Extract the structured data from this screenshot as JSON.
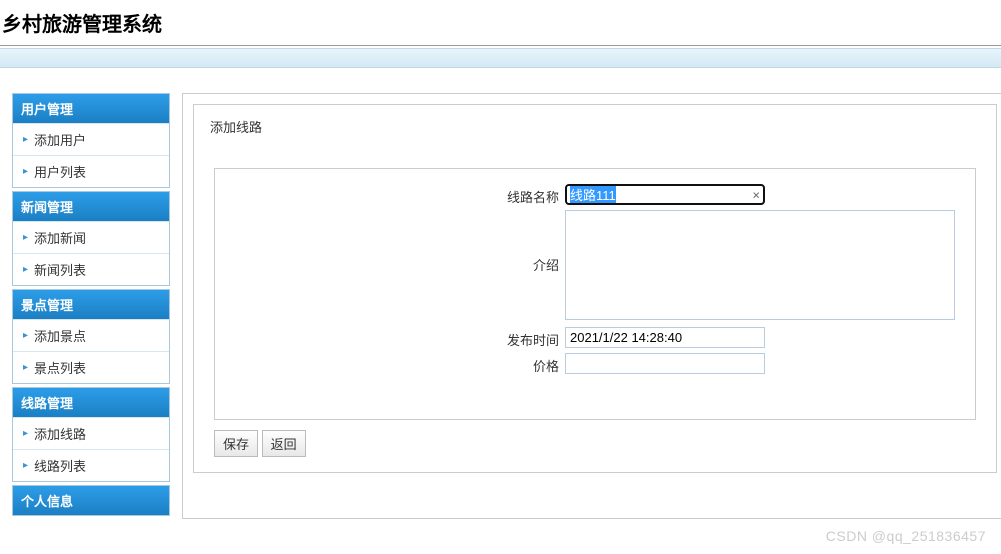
{
  "header": {
    "title": "乡村旅游管理系统"
  },
  "sidebar": {
    "sections": [
      {
        "header": "用户管理",
        "items": [
          {
            "label": "添加用户"
          },
          {
            "label": "用户列表"
          }
        ]
      },
      {
        "header": "新闻管理",
        "items": [
          {
            "label": "添加新闻"
          },
          {
            "label": "新闻列表"
          }
        ]
      },
      {
        "header": "景点管理",
        "items": [
          {
            "label": "添加景点"
          },
          {
            "label": "景点列表"
          }
        ]
      },
      {
        "header": "线路管理",
        "items": [
          {
            "label": "添加线路"
          },
          {
            "label": "线路列表"
          }
        ]
      },
      {
        "header": "个人信息",
        "items": []
      }
    ]
  },
  "main": {
    "title": "添加线路",
    "form": {
      "route_name_label": "线路名称",
      "route_name_value": "线路111",
      "intro_label": "介绍",
      "intro_value": "",
      "publish_time_label": "发布时间",
      "publish_time_value": "2021/1/22 14:28:40",
      "price_label": "价格",
      "price_value": ""
    },
    "actions": {
      "save": "保存",
      "back": "返回"
    }
  },
  "watermark": "CSDN @qq_251836457"
}
